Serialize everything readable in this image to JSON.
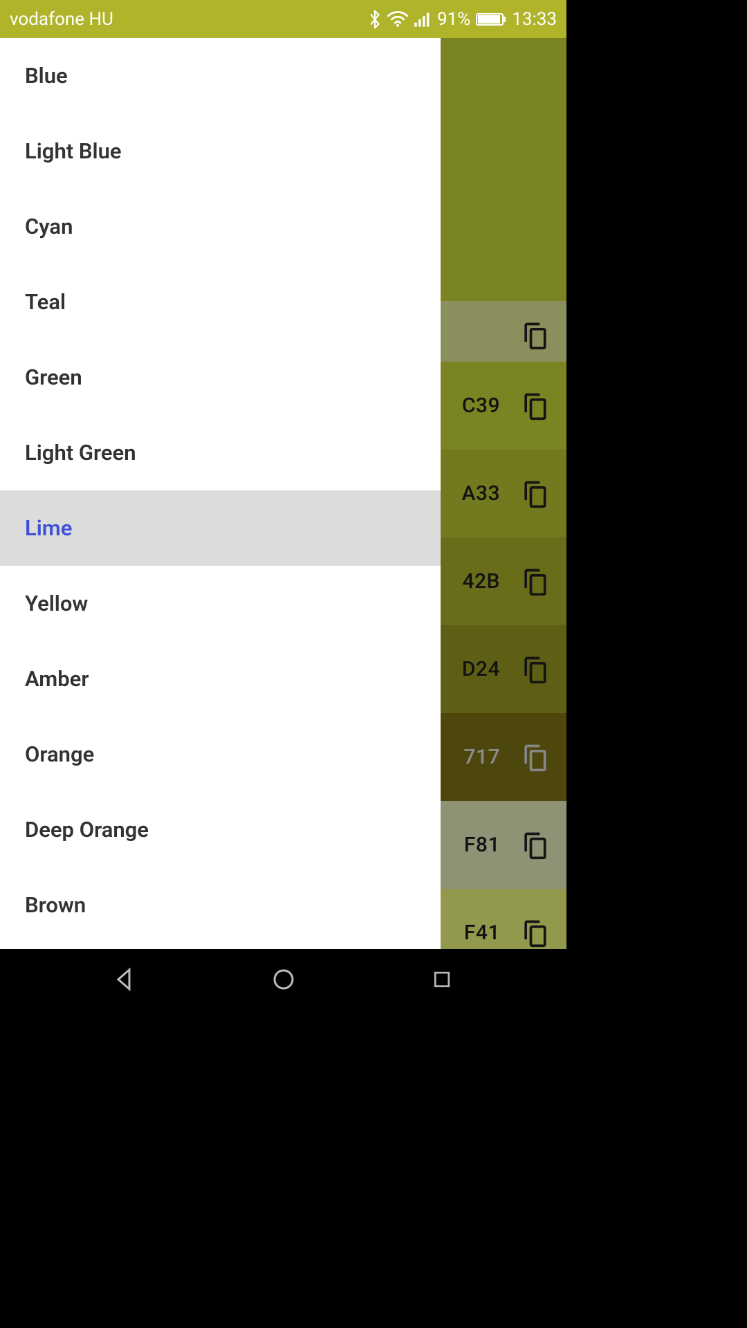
{
  "status": {
    "carrier": "vodafone HU",
    "battery_percent": "91%",
    "time": "13:33"
  },
  "drawer": {
    "selected_index": 6,
    "items": [
      {
        "label": "Blue"
      },
      {
        "label": "Light Blue"
      },
      {
        "label": "Cyan"
      },
      {
        "label": "Teal"
      },
      {
        "label": "Green"
      },
      {
        "label": "Light Green"
      },
      {
        "label": "Lime"
      },
      {
        "label": "Yellow"
      },
      {
        "label": "Amber"
      },
      {
        "label": "Orange"
      },
      {
        "label": "Deep Orange"
      },
      {
        "label": "Brown"
      }
    ]
  },
  "content": {
    "rows": [
      {
        "code_suffix": "",
        "bg": "#e6ee9c",
        "is_header_tail": true
      },
      {
        "code_suffix": "C39",
        "bg": "#cddc39"
      },
      {
        "code_suffix": "A33",
        "bg": "#c0ca33"
      },
      {
        "code_suffix": "42B",
        "bg": "#afb42b"
      },
      {
        "code_suffix": "D24",
        "bg": "#9e9d24"
      },
      {
        "code_suffix": "717",
        "bg": "#827717",
        "is_current": true
      },
      {
        "code_suffix": "F81",
        "bg": "#f0f4c3"
      },
      {
        "code_suffix": "F41",
        "bg": "#f4ff81"
      }
    ]
  }
}
